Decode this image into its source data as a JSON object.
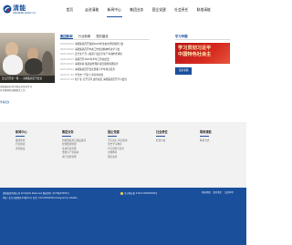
{
  "header": {
    "logo_text": "清能",
    "logo_sub": "QINGNENG GROUP CO.",
    "nav": [
      "首页",
      "走进清能",
      "新闻中心",
      "集团业务",
      "国企党建",
      "社会责任",
      "联络清能"
    ],
    "active_nav": 2
  },
  "hero": {
    "caption": "近日召开第一期……清能集团召开会议",
    "desc_line1": "清能集团召开专题会议传达学习",
    "desc_line2": "有关精神并部署相关工作。",
    "more": "查看更多"
  },
  "news": {
    "tabs": [
      "集团新闻",
      "行业新闻",
      "党的建设"
    ],
    "active_tab": 0,
    "items": [
      {
        "date": "2025.08.06",
        "title": "清能集团召开集团2025年生态文明思想研讨会"
      },
      {
        "date": "2025.08.06",
        "title": "清能集团召开中央工作会议精神传达学习会"
      },
      {
        "date": "2025.08.05",
        "title": "安全生产月 | 集团下发安全生产专项检查通知"
      },
      {
        "date": "2025.08.05",
        "title": "清能召开2025年半年工作总结会"
      },
      {
        "date": "2025.08.05",
        "title": "清能新闻 集团总经理赴项目现场调研指导"
      },
      {
        "date": "2025.08.02",
        "title": "清能集团召开会议部署下半年重点任务"
      },
      {
        "date": "2025.07.29",
        "title": "学党史一行赴上海考察交流"
      },
      {
        "date": "2025.07.28",
        "title": "新产业 打开空间 这份总结 清能集团召开学习会议"
      }
    ]
  },
  "study": {
    "title": "学习专题",
    "banner_line1": "学习贯彻习近平",
    "banner_line2": "中国特色社会主",
    "button": "更多专题"
  },
  "footer_links": [
    {
      "title": "新闻中心",
      "links": [
        "集团新闻",
        "行业新闻",
        "党的建设"
      ]
    },
    {
      "title": "集团业务",
      "links": [
        "新能源投资与建设运营",
        "智慧能源管理",
        "生态环境治理",
        "金融与产业投资",
        "资产运营管理"
      ]
    },
    {
      "title": "国企党建",
      "links": [
        "不忘初心 牢记使命",
        "党史学习教育",
        "学习贯彻习近平",
        "主题教育",
        "国企改革"
      ]
    },
    {
      "title": "社会责任",
      "links": [
        "社会公益"
      ]
    },
    {
      "title": "联络清能",
      "links": [
        "联系方式"
      ]
    }
  ],
  "footer": {
    "copyright": "清能集团有限公司 All Rights Reserved 版权所有 京ICP备10000号",
    "address": "地址: 北京市朝阳区XX路XX号 电话: 010-00000000 Designed by WebRe",
    "beian": "京公网安备 11011100000000号",
    "badges": [
      "网站地图",
      "联系我们",
      "法律声明"
    ]
  },
  "colors": {
    "brand": "#1a4f9c",
    "accent_red": "#c81a1f",
    "footer_bg": "#f2f2f2"
  },
  "icons": [
    "logo-icon",
    "police-badge-icon"
  ]
}
